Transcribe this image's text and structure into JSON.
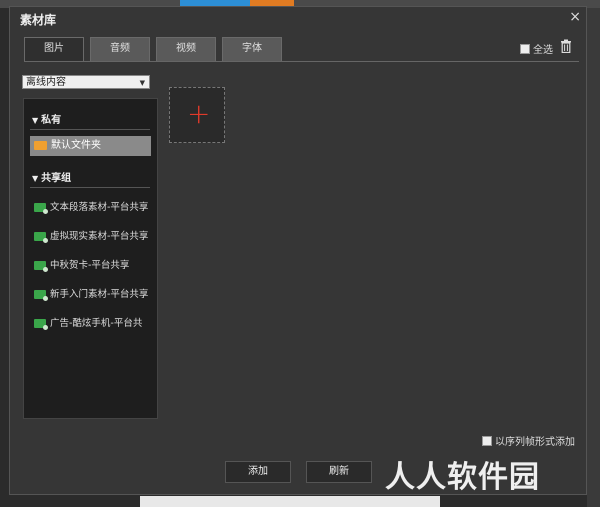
{
  "dialog": {
    "title": "素材库",
    "close_icon": "×"
  },
  "tabs": [
    {
      "label": "图片"
    },
    {
      "label": "音频"
    },
    {
      "label": "视频"
    },
    {
      "label": "字体"
    }
  ],
  "toolbar": {
    "select_all_label": "全选"
  },
  "filter": {
    "selected": "离线内容"
  },
  "sidebar": {
    "private_label": "私有",
    "default_folder": "默认文件夹",
    "shared_label": "共享组",
    "groups": [
      "文本段落素材-平台共享",
      "虚拟现实素材-平台共享",
      "中秋贺卡-平台共享",
      "新手入门素材-平台共享",
      "广告-酷炫手机-平台共"
    ]
  },
  "options": {
    "sequence_label": "以序列帧形式添加"
  },
  "buttons": {
    "add": "添加",
    "refresh": "刷新"
  },
  "watermark": "人人软件园",
  "colors": {
    "accent_red": "#e03a2a",
    "folder_orange": "#f0a030",
    "group_green": "#3aa64a"
  }
}
